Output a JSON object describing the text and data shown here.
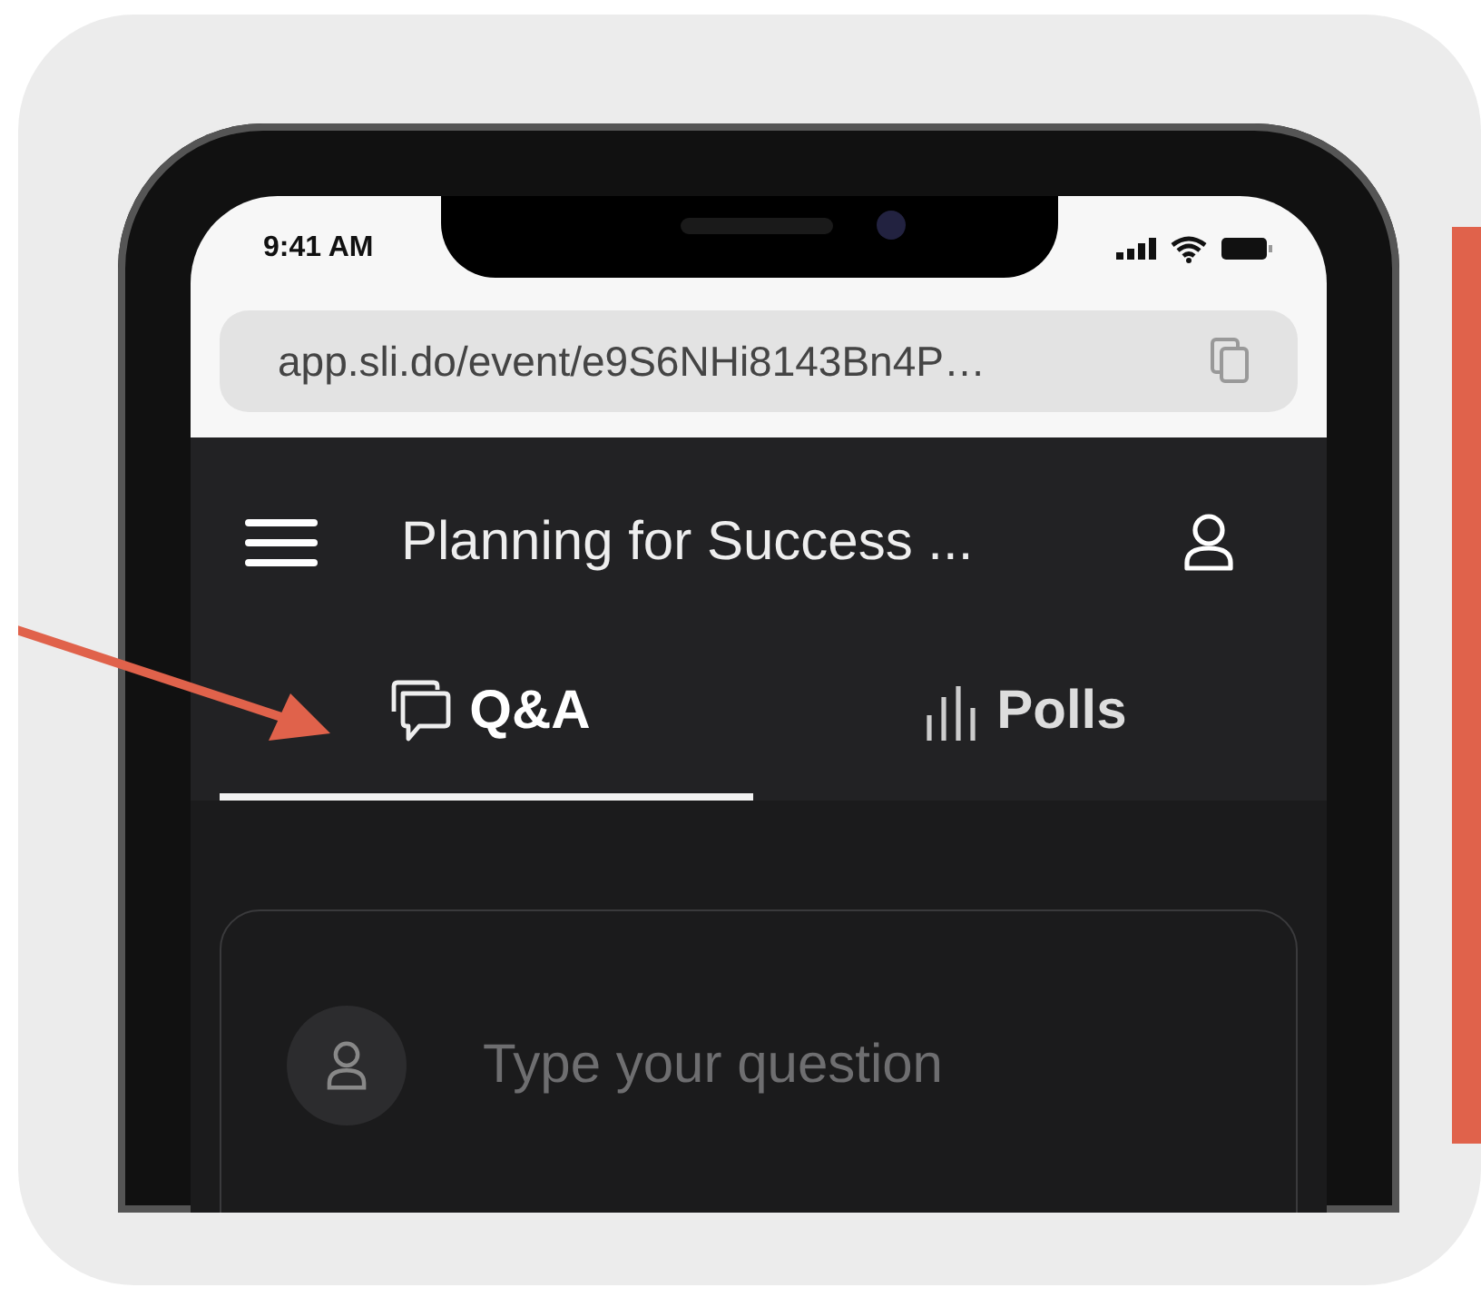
{
  "status_bar": {
    "time": "9:41 AM"
  },
  "address_bar": {
    "url": "app.sli.do/event/e9S6NHi8143Bn4P…"
  },
  "header": {
    "title": "Planning for Success ..."
  },
  "tabs": [
    {
      "label": "Q&A",
      "kind": "qa",
      "selected": true
    },
    {
      "label": "Polls",
      "kind": "polls",
      "selected": false
    }
  ],
  "question_input": {
    "placeholder": "Type your question"
  }
}
